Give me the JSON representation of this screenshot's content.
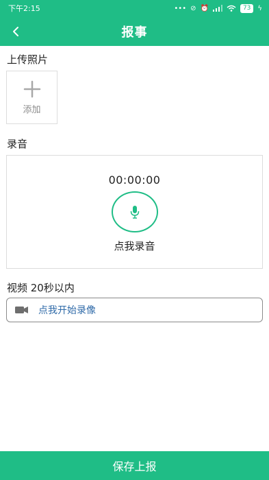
{
  "status_bar": {
    "time": "下午2:15",
    "battery": "73"
  },
  "header": {
    "title": "报事"
  },
  "photo": {
    "label": "上传照片",
    "add_text": "添加"
  },
  "audio": {
    "label": "录音",
    "timer": "00:00:00",
    "record_text": "点我录音"
  },
  "video": {
    "label": "视频 20秒以内",
    "button_text": "点我开始录像"
  },
  "footer": {
    "save_label": "保存上报"
  },
  "colors": {
    "primary": "#1fbd86",
    "link": "#2f6aa8"
  },
  "icons": [
    "back-arrow-icon",
    "plus-icon",
    "microphone-icon",
    "video-camera-icon",
    "wifi-icon",
    "signal-icon",
    "battery-icon"
  ]
}
